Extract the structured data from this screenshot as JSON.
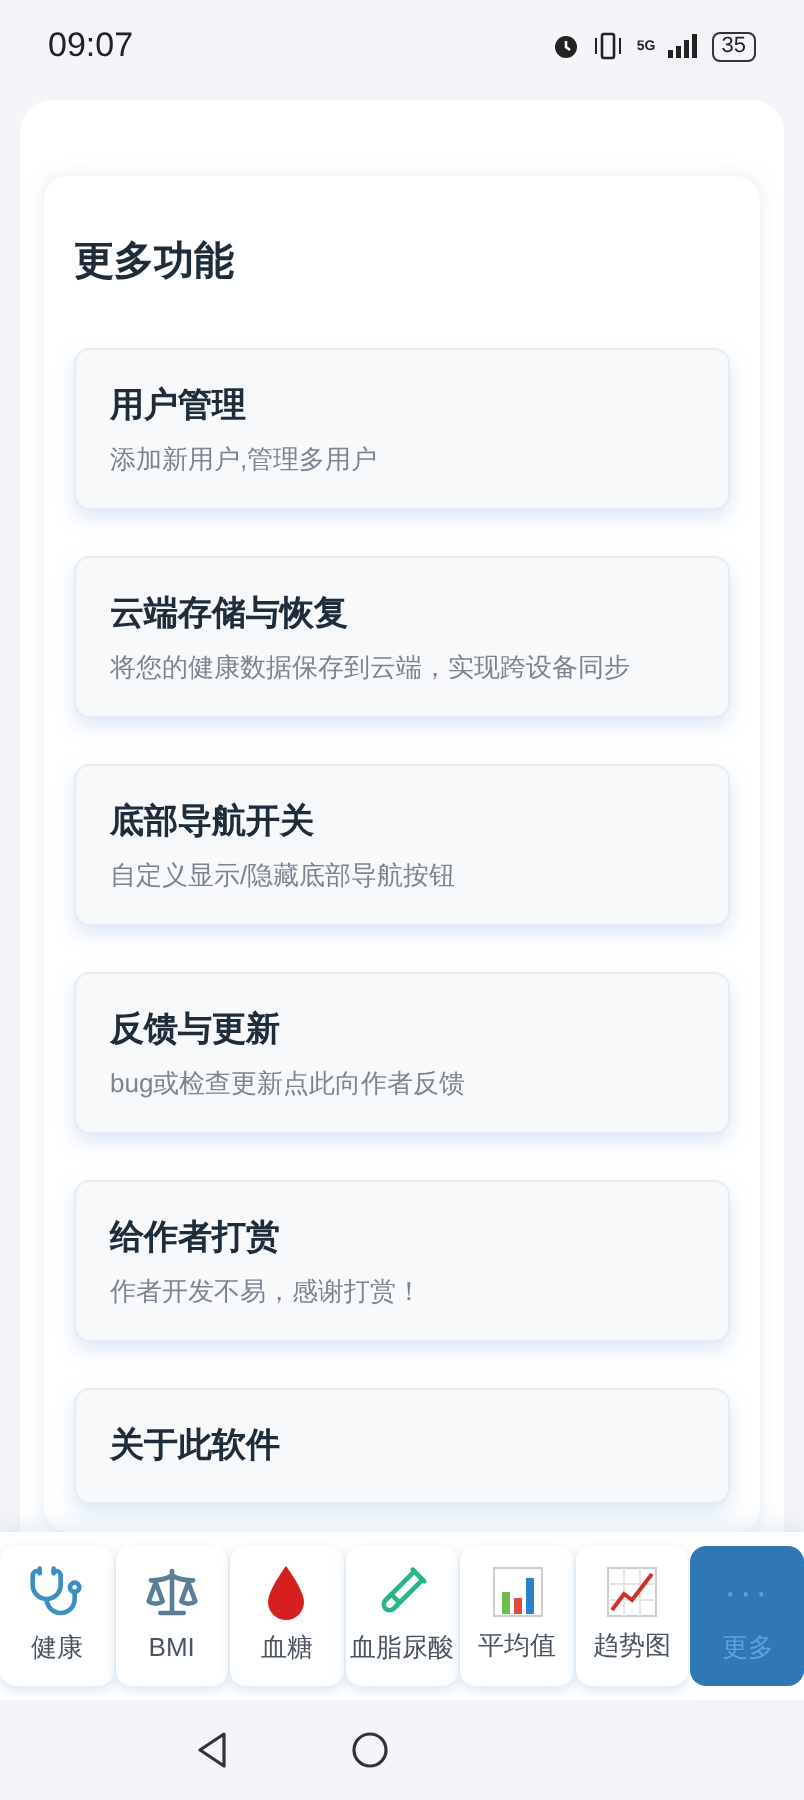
{
  "status_bar": {
    "time": "09:07",
    "network": "5G",
    "battery": "35"
  },
  "section": {
    "title": "更多功能",
    "items": [
      {
        "title": "用户管理",
        "subtitle": "添加新用户,管理多用户"
      },
      {
        "title": "云端存储与恢复",
        "subtitle": "将您的健康数据保存到云端，实现跨设备同步"
      },
      {
        "title": "底部导航开关",
        "subtitle": "自定义显示/隐藏底部导航按钮"
      },
      {
        "title": "反馈与更新",
        "subtitle": "bug或检查更新点此向作者反馈"
      },
      {
        "title": "给作者打赏",
        "subtitle": "作者开发不易，感谢打赏！"
      },
      {
        "title": "关于此软件"
      }
    ]
  },
  "bottom_nav": [
    {
      "kind": "stethoscope",
      "label": "健康",
      "selected": false
    },
    {
      "kind": "scale",
      "label": "BMI",
      "selected": false
    },
    {
      "kind": "drop",
      "label": "血糖",
      "selected": false
    },
    {
      "kind": "tube",
      "label": "血脂尿酸",
      "selected": false
    },
    {
      "kind": "bars",
      "label": "平均值",
      "selected": false
    },
    {
      "kind": "trend",
      "label": "趋势图",
      "selected": false
    },
    {
      "kind": "dots",
      "glyph": "···",
      "label": "更多",
      "selected": true
    }
  ]
}
